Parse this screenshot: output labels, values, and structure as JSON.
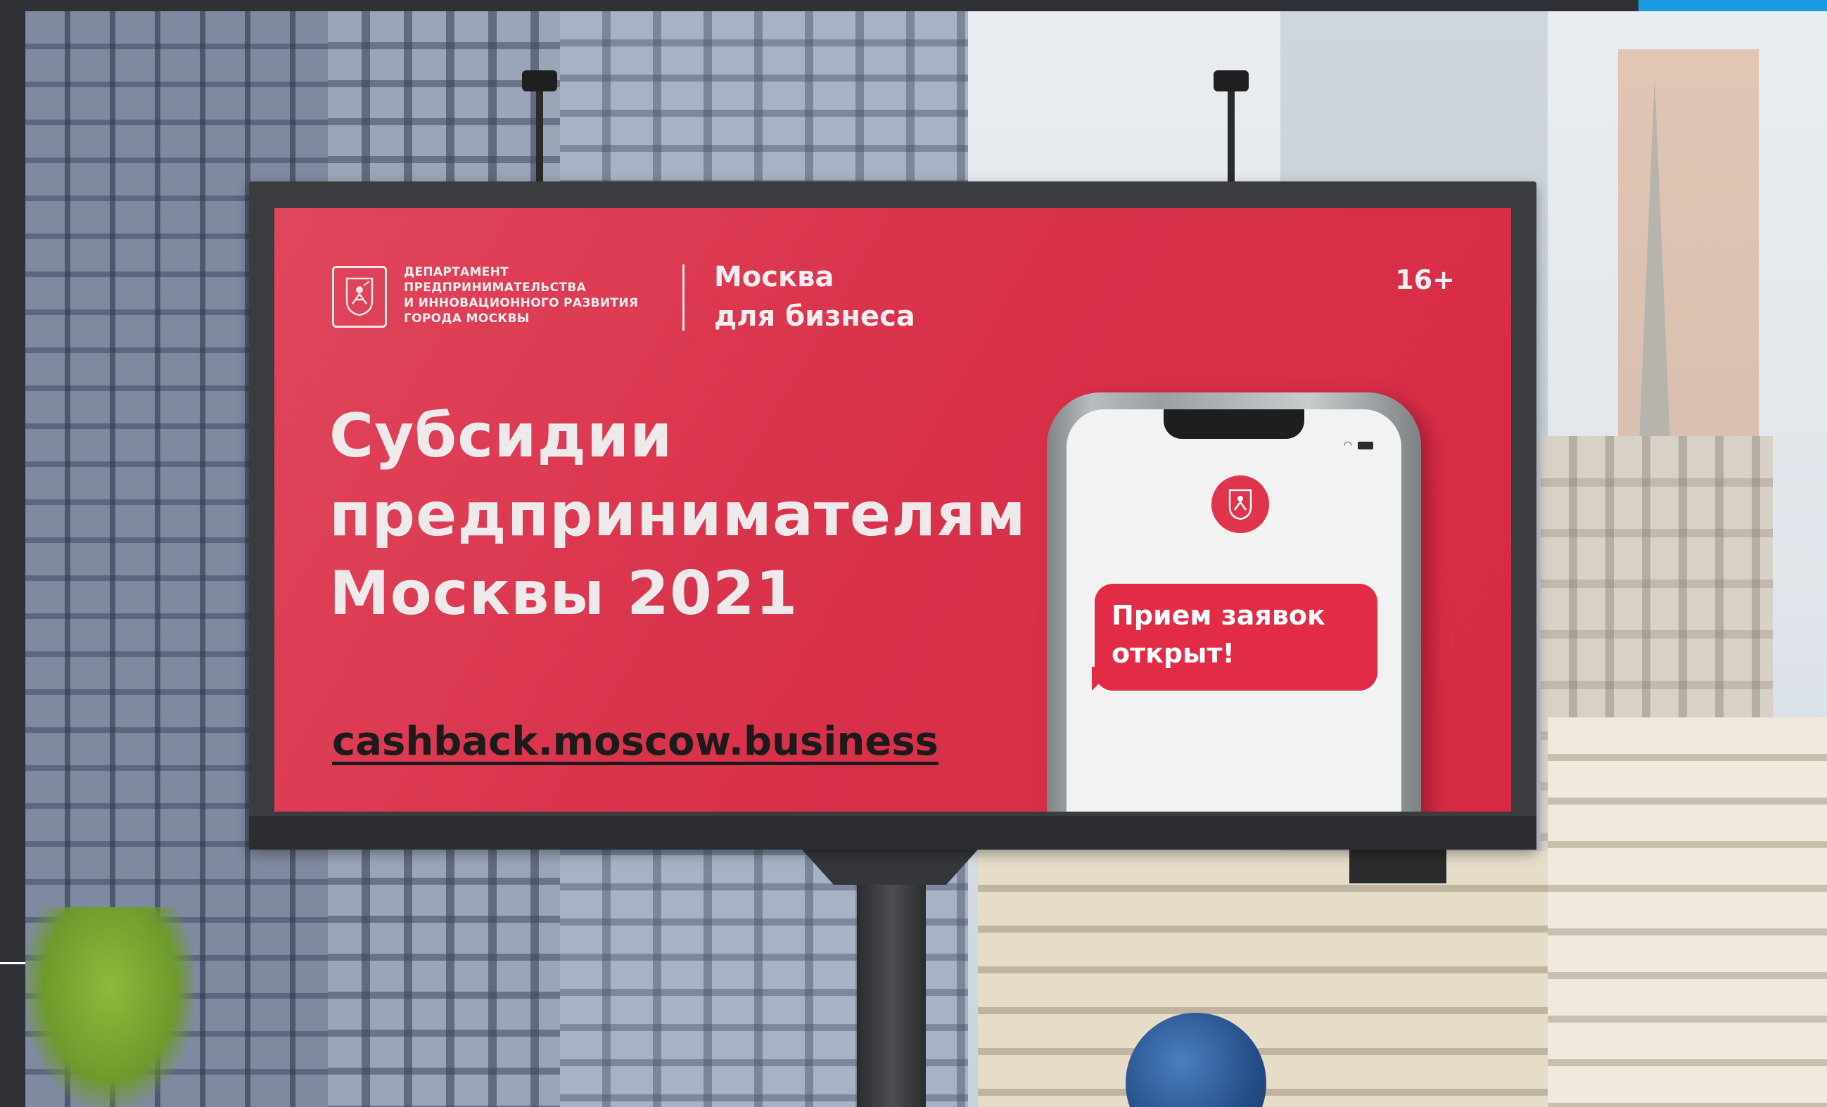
{
  "billboard": {
    "department": {
      "line1": "ДЕПАРТАМЕНТ",
      "line2": "ПРЕДПРИНИМАТЕЛЬСТВА",
      "line3": "И ИННОВАЦИОННОГО РАЗВИТИЯ",
      "line4": "ГОРОДА МОСКВЫ"
    },
    "brand": {
      "line1": "Москва",
      "line2": "для бизнеса"
    },
    "age_rating": "16+",
    "headline": {
      "line1": "Субсидии",
      "line2": "предпринимателям",
      "line3": "Москвы 2021"
    },
    "url": "cashback.moscow.business",
    "phone": {
      "message_line1": "Прием заявок",
      "message_line2": "открыт!",
      "app_icon": "moscow-coat-of-arms-icon"
    }
  },
  "colors": {
    "panel_red": "#d9324b",
    "text_light": "#eeeaec",
    "url_dark": "#1b1b1b",
    "accent_blue": "#1a9be0"
  }
}
